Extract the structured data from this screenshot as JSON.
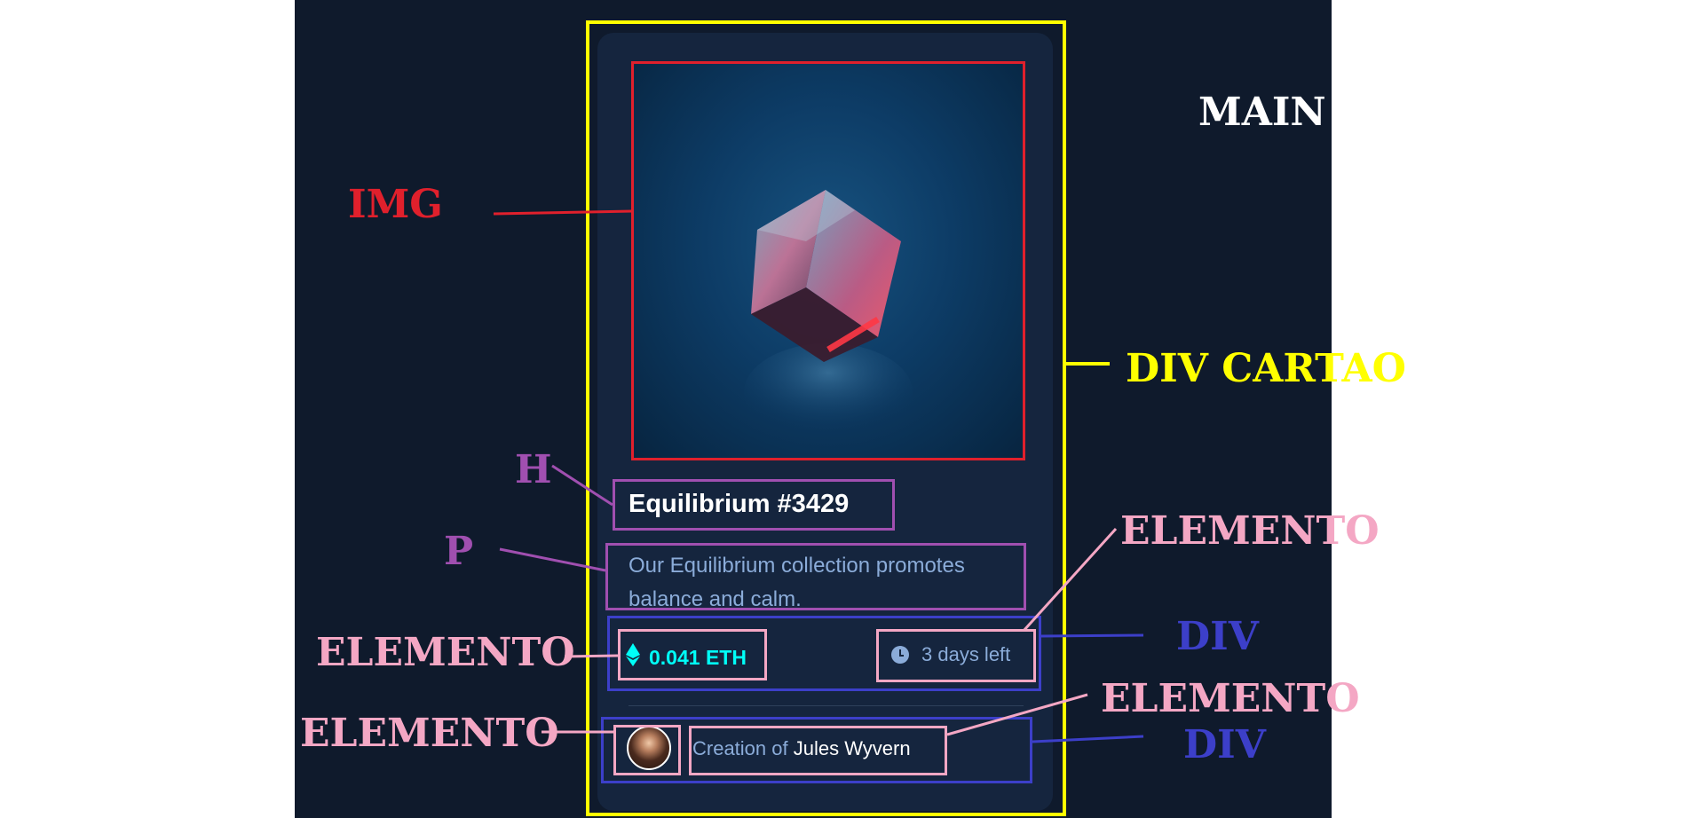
{
  "card": {
    "title": "Equilibrium #3429",
    "description": "Our Equilibrium collection promotes balance and calm.",
    "price": "0.041 ETH",
    "time_left": "3 days left",
    "creator_prefix": "Creation of",
    "creator_name": "Jules Wyvern",
    "colors": {
      "background": "#0f1a2c",
      "card": "#15253e",
      "accent": "#00fff8",
      "muted": "#8bacd9"
    }
  },
  "annotations": {
    "main": "MAIN",
    "img": "IMG",
    "div_cartao": "DIV CARTAO",
    "h": "H",
    "p": "P",
    "elemento_time": "ELEMENTO",
    "elemento_price": "ELEMENTO",
    "div_stats": "DIV",
    "elemento_creator": "ELEMENTO",
    "elemento_avatar": "ELEMENTO",
    "div_creator": "DIV",
    "colors": {
      "main": "#ffffff",
      "img": "#e0202c",
      "card": "#ffff00",
      "heading": "#a04fb0",
      "element": "#f4a7c4",
      "div": "#3c3fc9"
    }
  },
  "icons": [
    "ethereum-icon",
    "clock-icon"
  ]
}
